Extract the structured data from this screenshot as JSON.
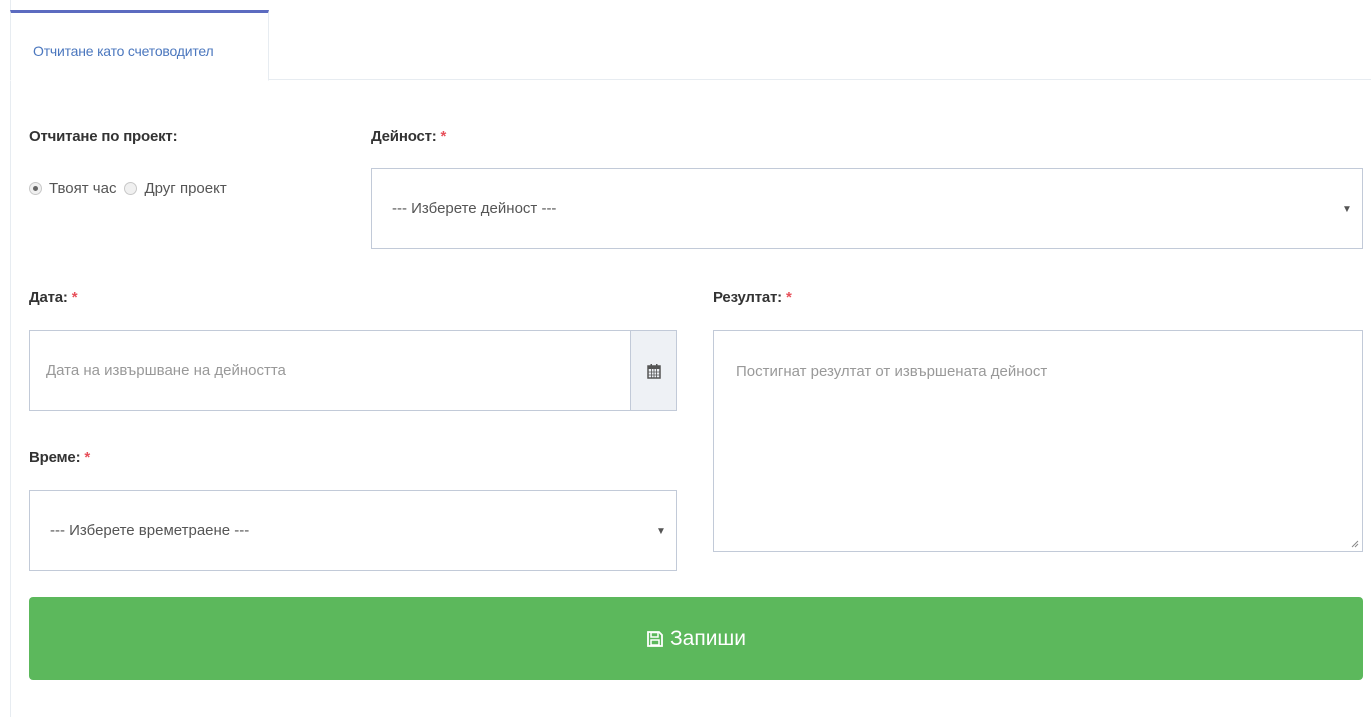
{
  "tabs": [
    {
      "label": "Отчитане като счетоводител",
      "active": true
    }
  ],
  "project": {
    "label": "Отчитане по проект:",
    "options": [
      {
        "label": "Твоят час",
        "checked": true
      },
      {
        "label": "Друг проект",
        "checked": false
      }
    ]
  },
  "activity": {
    "label": "Дейност:",
    "required_mark": "*",
    "selected": "--- Изберете дейност ---"
  },
  "date": {
    "label": "Дата:",
    "required_mark": "*",
    "placeholder": "Дата на извършване на дейността",
    "icon": "calendar-icon"
  },
  "time": {
    "label": "Време:",
    "required_mark": "*",
    "selected": "--- Изберете времетраене ---"
  },
  "result": {
    "label": "Резултат:",
    "required_mark": "*",
    "placeholder": "Постигнат резултат от извършената дейност"
  },
  "save_button": {
    "label": "Запиши",
    "icon": "floppy-disk-icon",
    "color": "#5cb85c"
  },
  "colors": {
    "accent": "#5c6bc0",
    "tab_text": "#4b77be",
    "required": "#e7505a",
    "border": "#c2cad8"
  }
}
